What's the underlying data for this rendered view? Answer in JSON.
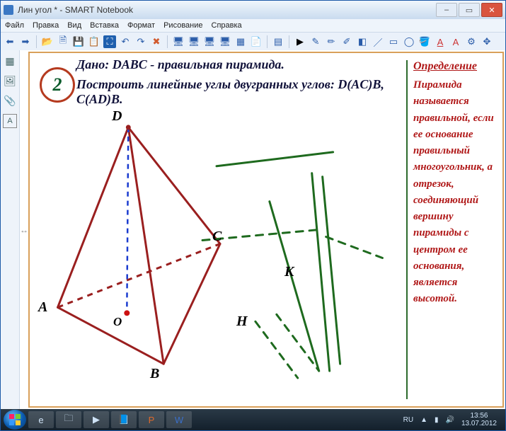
{
  "window": {
    "title": "Лин угол * - SMART Notebook",
    "min": "–",
    "max": "▭",
    "close": "✕"
  },
  "menu": {
    "file": "Файл",
    "edit": "Правка",
    "view": "Вид",
    "insert": "Вставка",
    "format": "Формат",
    "draw": "Рисование",
    "help": "Справка"
  },
  "sidebar": {
    "pages": "▦",
    "gallery": "🖼",
    "attach": "📎",
    "text": "A"
  },
  "canvas": {
    "num": "2",
    "given": "Дано: DABC - правильная пирамида.",
    "task": "Построить линейные углы двугранных углов: D(AC)B, C(AD)B.",
    "labels": {
      "D": "D",
      "A": "A",
      "B": "B",
      "C": "C",
      "O": "O",
      "K": "K",
      "H": "H"
    },
    "def_head": "Определение",
    "def_body": "Пирамида называется правильной, если ее основание правильный многоугольник, а отрезок, соединяющий вершину пирамиды с центром ее основания, является высотой."
  },
  "tray": {
    "lang": "RU",
    "time": "13:56",
    "date": "13.07.2012"
  }
}
